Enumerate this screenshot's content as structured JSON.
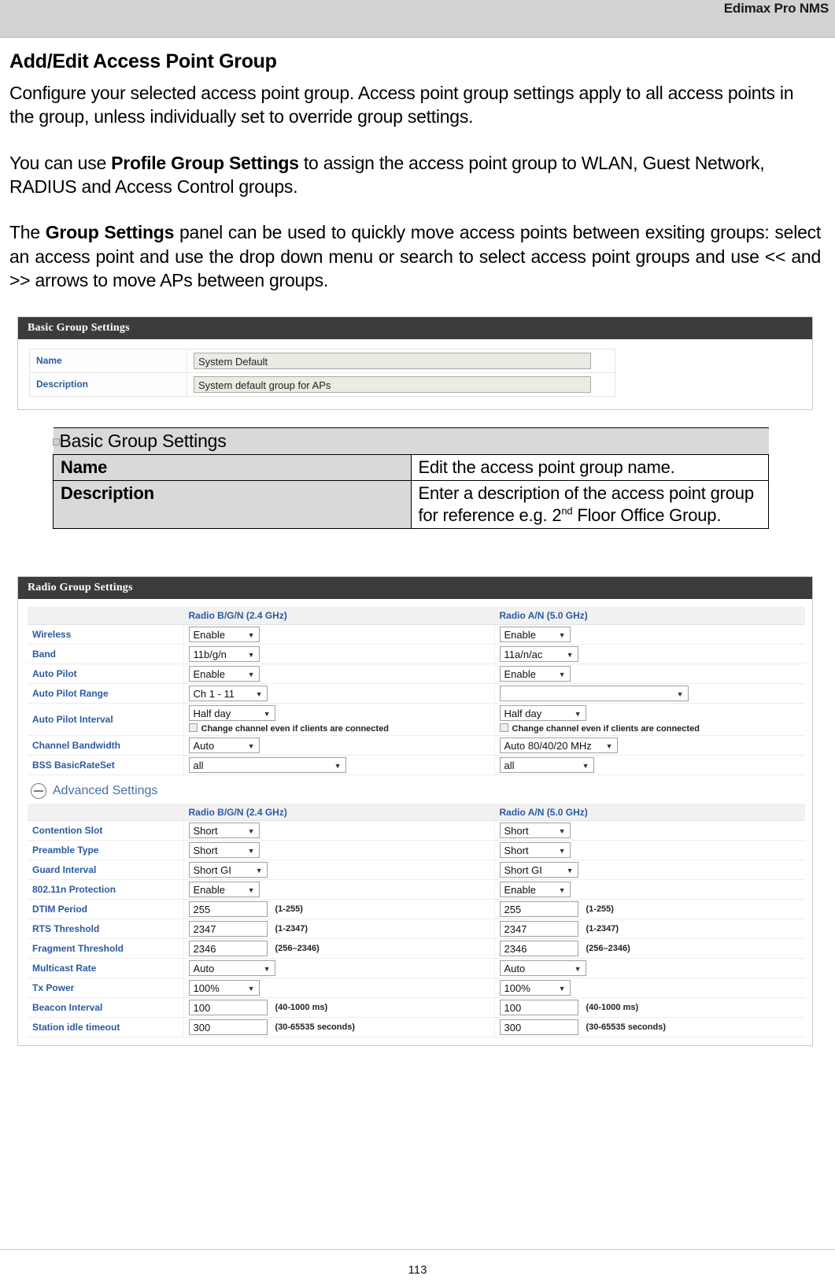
{
  "header": {
    "running_title": "Edimax Pro NMS"
  },
  "doc": {
    "title": "Add/Edit Access Point Group",
    "para1": "Configure your selected access point group. Access point group settings apply to all access points in the group, unless individually set to override group settings.",
    "para2_a": "You can use ",
    "para2_b": "Profile Group Settings",
    "para2_c": " to assign the access point group to WLAN, Guest Network, RADIUS and Access Control groups.",
    "para3_a": "The ",
    "para3_b": "Group Settings",
    "para3_c": " panel can be used to quickly move access points between exsiting groups: select an access point and use the drop down menu or search to select access point groups and use << and >> arrows to move APs between groups."
  },
  "basic_shot": {
    "panel_title": "Basic Group Settings",
    "rows": [
      {
        "label": "Name",
        "value": "System Default"
      },
      {
        "label": "Description",
        "value": "System default group for APs"
      }
    ]
  },
  "desc_table": {
    "head": "Basic Group Settings",
    "rows": [
      {
        "key": "Name",
        "value": "Edit the access point group name."
      },
      {
        "key": "Description",
        "value_line1": "Enter a description of the access point group",
        "value_line2_a": "for reference e.g. 2",
        "value_line2_sup": "nd",
        "value_line2_b": " Floor Office Group."
      }
    ]
  },
  "radio_shot": {
    "panel_title": "Radio Group Settings",
    "col_24": "Radio B/G/N (2.4 GHz)",
    "col_50": "Radio A/N (5.0 GHz)",
    "checkbox_label": "Change channel even if clients are connected",
    "advanced_label": "Advanced Settings",
    "basic_rows": [
      {
        "label": "Wireless",
        "v24": "Enable",
        "v50": "Enable"
      },
      {
        "label": "Band",
        "v24": "11b/g/n",
        "v50": "11a/n/ac"
      },
      {
        "label": "Auto Pilot",
        "v24": "Enable",
        "v50": "Enable"
      },
      {
        "label": "Auto Pilot Range",
        "v24": "Ch 1 - 11",
        "v50": ""
      },
      {
        "label": "Auto Pilot Interval",
        "v24": "Half day",
        "v50": "Half day"
      },
      {
        "label": "Channel Bandwidth",
        "v24": "Auto",
        "v50": "Auto 80/40/20 MHz"
      },
      {
        "label": "BSS BasicRateSet",
        "v24": "all",
        "v50": "all"
      }
    ],
    "advanced_rows": [
      {
        "label": "Contention Slot",
        "type": "select",
        "v24": "Short",
        "v50": "Short",
        "hint": ""
      },
      {
        "label": "Preamble Type",
        "type": "select",
        "v24": "Short",
        "v50": "Short",
        "hint": ""
      },
      {
        "label": "Guard Interval",
        "type": "select",
        "v24": "Short GI",
        "v50": "Short GI",
        "hint": ""
      },
      {
        "label": "802.11n Protection",
        "type": "select",
        "v24": "Enable",
        "v50": "Enable",
        "hint": ""
      },
      {
        "label": "DTIM Period",
        "type": "input",
        "v24": "255",
        "v50": "255",
        "hint": "(1-255)"
      },
      {
        "label": "RTS Threshold",
        "type": "input",
        "v24": "2347",
        "v50": "2347",
        "hint": "(1-2347)"
      },
      {
        "label": "Fragment Threshold",
        "type": "input",
        "v24": "2346",
        "v50": "2346",
        "hint": "(256–2346)"
      },
      {
        "label": "Multicast Rate",
        "type": "select",
        "v24": "Auto",
        "v50": "Auto",
        "hint": ""
      },
      {
        "label": "Tx Power",
        "type": "select",
        "v24": "100%",
        "v50": "100%",
        "hint": ""
      },
      {
        "label": "Beacon Interval",
        "type": "input",
        "v24": "100",
        "v50": "100",
        "hint": "(40-1000 ms)"
      },
      {
        "label": "Station idle timeout",
        "type": "input",
        "v24": "300",
        "v50": "300",
        "hint": "(30-65535 seconds)"
      }
    ]
  },
  "footer": {
    "page_number": "113"
  }
}
